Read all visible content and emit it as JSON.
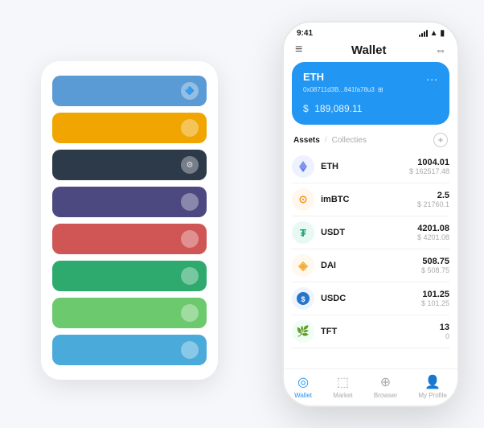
{
  "scene": {
    "bg_color": "#f5f7fa"
  },
  "card_stack": {
    "items": [
      {
        "color": "#5B9BD5",
        "icon": "🔷"
      },
      {
        "color": "#F0A500",
        "icon": "🟡"
      },
      {
        "color": "#2D3A4A",
        "icon": "⚙"
      },
      {
        "color": "#4B4980",
        "icon": "⬡"
      },
      {
        "color": "#E05C5C",
        "icon": "🔴"
      },
      {
        "color": "#2EAA6E",
        "icon": "🟢"
      },
      {
        "color": "#6DC96D",
        "icon": "🟩"
      },
      {
        "color": "#4AABDB",
        "icon": "🔵"
      }
    ]
  },
  "phone": {
    "status_bar": {
      "time": "9:41",
      "signal": true,
      "wifi": true,
      "battery": true
    },
    "header": {
      "menu_icon": "≡",
      "title": "Wallet",
      "expand_icon": "⇔"
    },
    "eth_card": {
      "title": "ETH",
      "dots": "...",
      "address": "0x08711d3B...841fa78u3",
      "copy_icon": "⊞",
      "balance_prefix": "$",
      "balance": "189,089.11"
    },
    "assets": {
      "tab_active": "Assets",
      "tab_divider": "/",
      "tab_inactive": "Collecties",
      "add_icon": "+"
    },
    "asset_list": [
      {
        "symbol": "ETH",
        "icon_color": "#627EEA",
        "icon_char": "♦",
        "amount": "1004.01",
        "usd": "$ 162517.48"
      },
      {
        "symbol": "imBTC",
        "icon_color": "#F7931A",
        "icon_char": "⊙",
        "amount": "2.5",
        "usd": "$ 21760.1"
      },
      {
        "symbol": "USDT",
        "icon_color": "#26A17B",
        "icon_char": "₮",
        "amount": "4201.08",
        "usd": "$ 4201.08"
      },
      {
        "symbol": "DAI",
        "icon_color": "#F5AC37",
        "icon_char": "◈",
        "amount": "508.75",
        "usd": "$ 508.75"
      },
      {
        "symbol": "USDC",
        "icon_color": "#2775CA",
        "icon_char": "©",
        "amount": "101.25",
        "usd": "$ 101.25"
      },
      {
        "symbol": "TFT",
        "icon_color": "#8B5CF6",
        "icon_char": "🌿",
        "amount": "13",
        "usd": "0"
      }
    ],
    "bottom_nav": [
      {
        "label": "Wallet",
        "icon": "◎",
        "active": true
      },
      {
        "label": "Market",
        "icon": "📊",
        "active": false
      },
      {
        "label": "Browser",
        "icon": "👤",
        "active": false
      },
      {
        "label": "My Profile",
        "icon": "👤",
        "active": false
      }
    ]
  }
}
